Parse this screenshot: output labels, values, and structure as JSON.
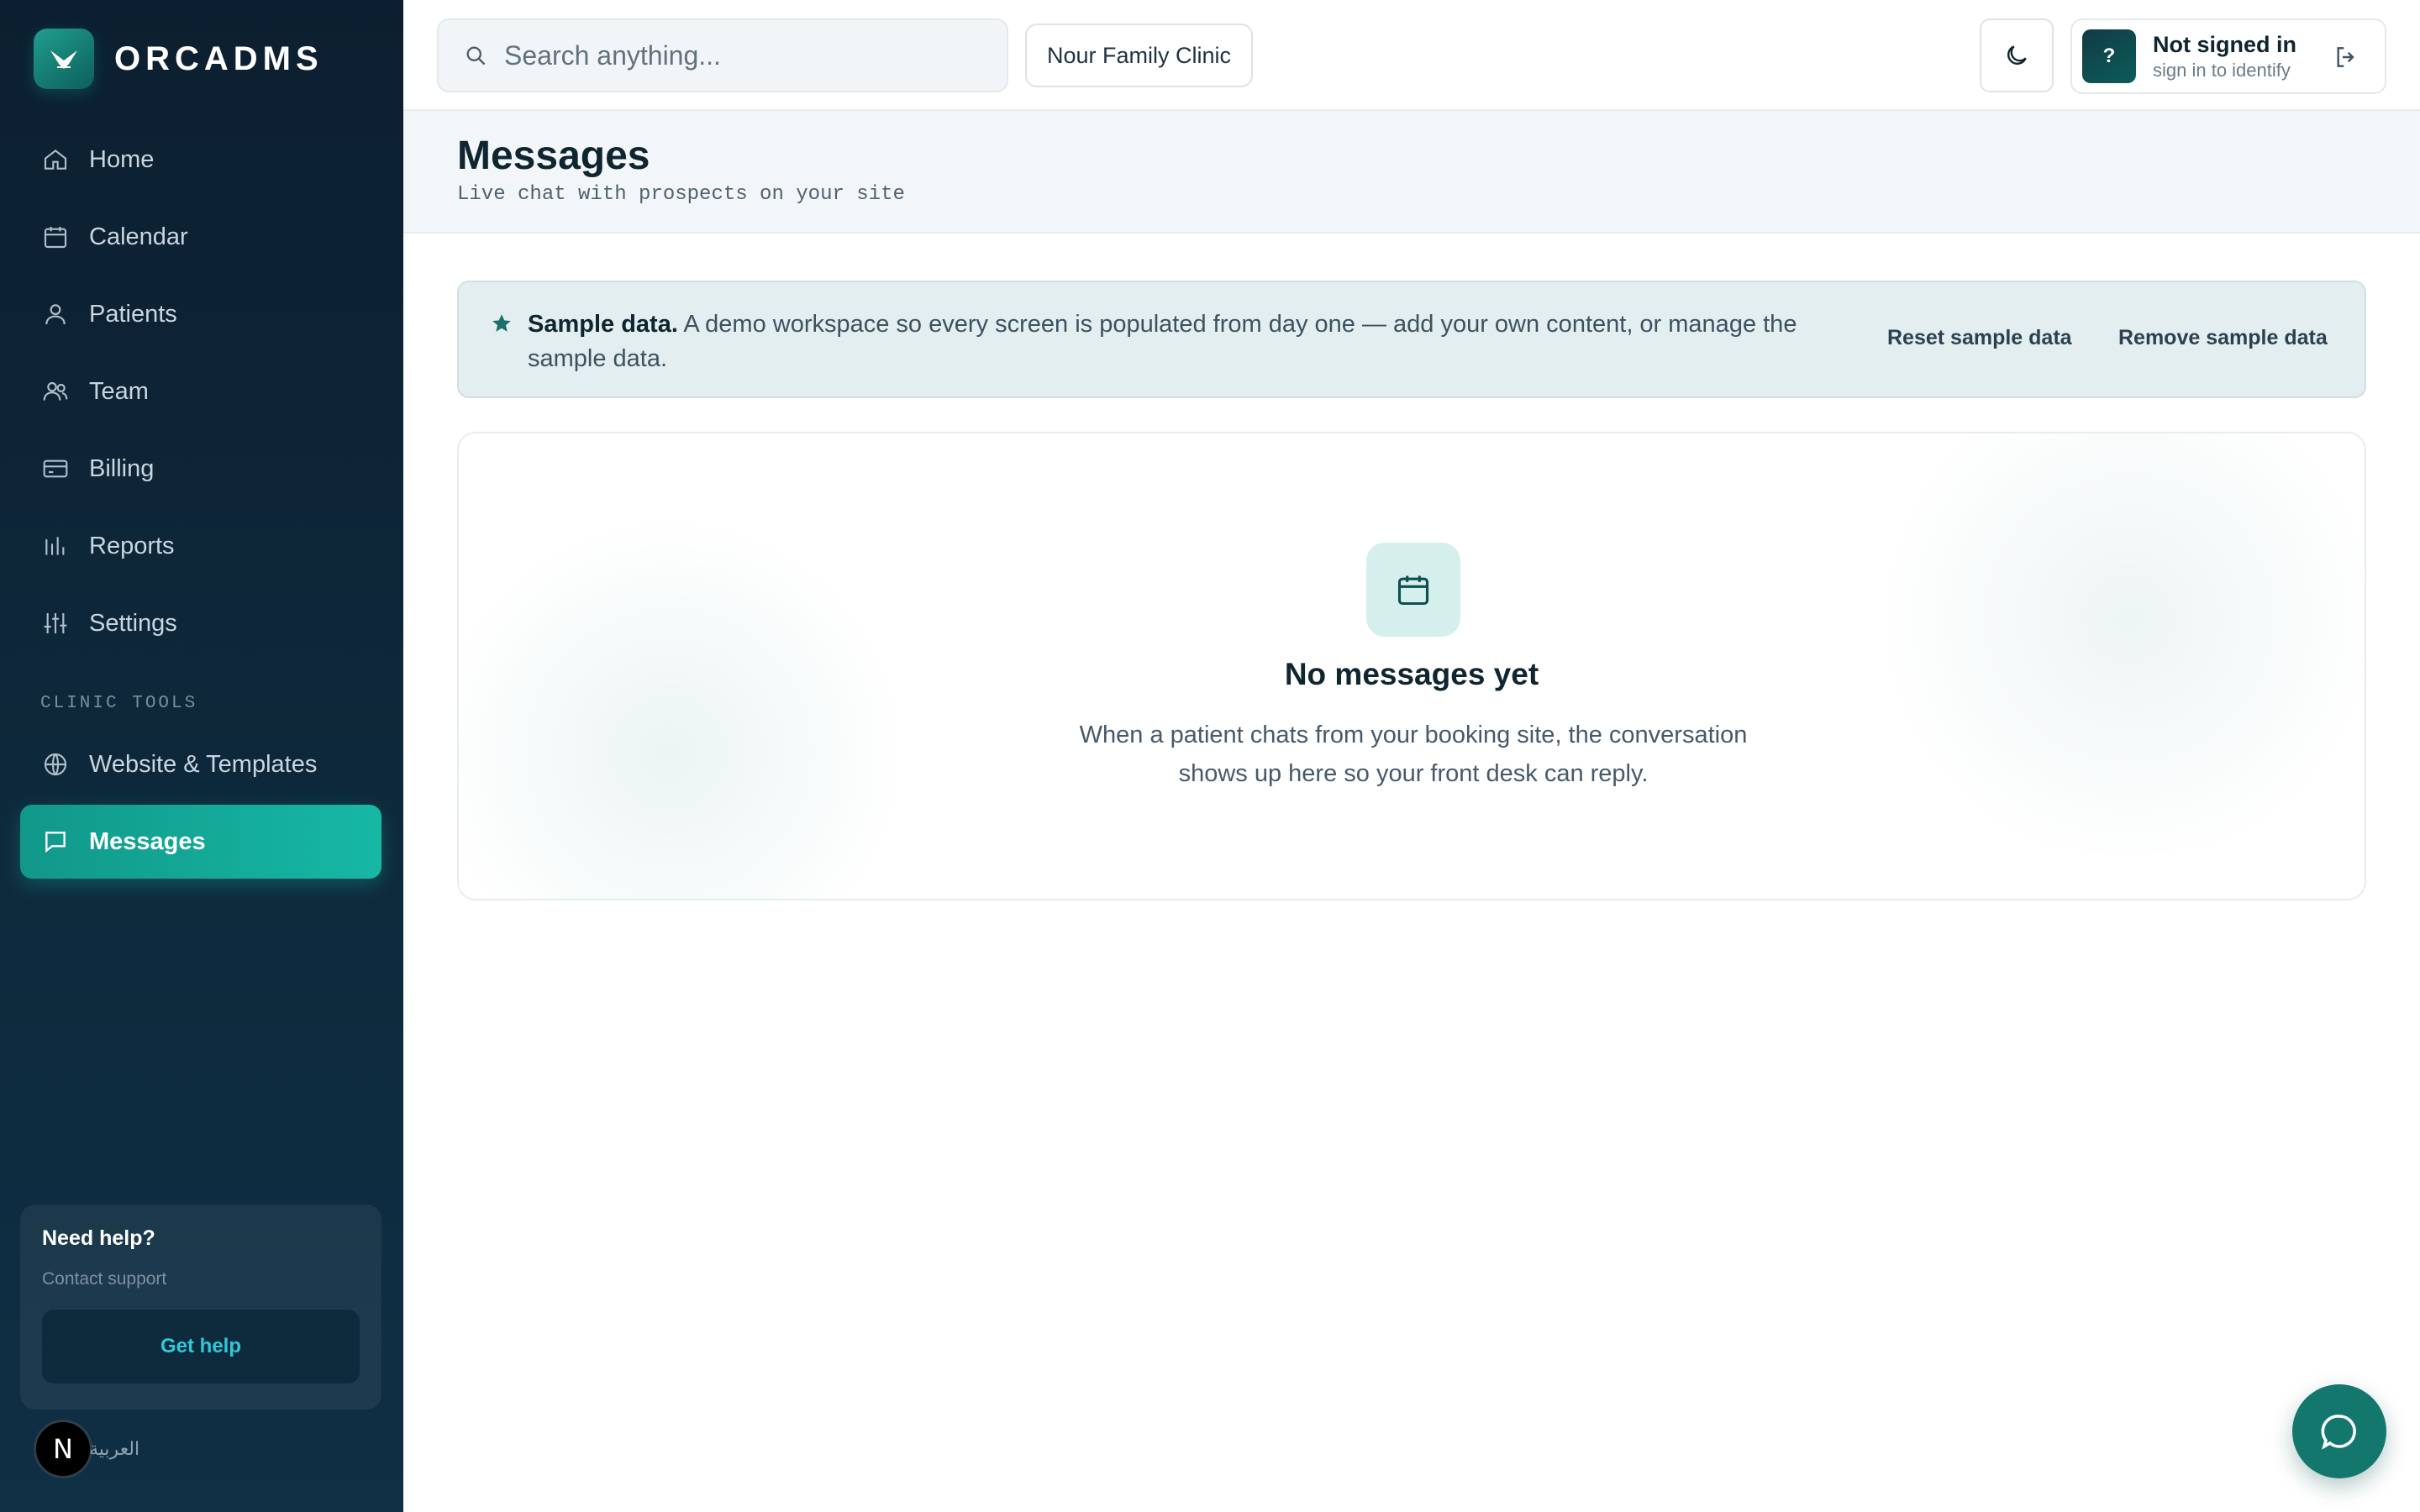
{
  "app": {
    "name": "ORCADMS"
  },
  "sidebar": {
    "items": [
      {
        "label": "Home"
      },
      {
        "label": "Calendar"
      },
      {
        "label": "Patients"
      },
      {
        "label": "Team"
      },
      {
        "label": "Billing"
      },
      {
        "label": "Reports"
      },
      {
        "label": "Settings"
      }
    ],
    "section_label": "CLINIC TOOLS",
    "tools": [
      {
        "label": "Website & Templates"
      },
      {
        "label": "Messages",
        "active": true
      }
    ],
    "help": {
      "title": "Need help?",
      "subtitle": "Contact support",
      "button": "Get help"
    },
    "language": {
      "avatar": "N",
      "label": "العربية"
    }
  },
  "topbar": {
    "search_placeholder": "Search anything...",
    "clinic": "Nour Family Clinic",
    "user": {
      "avatar": "?",
      "name": "Not signed in",
      "subtitle": "sign in to identify"
    }
  },
  "page": {
    "title": "Messages",
    "subtitle": "Live chat with prospects on your site"
  },
  "banner": {
    "strong": "Sample data.",
    "text": " A demo workspace so every screen is populated from day one — add your own content, or manage the sample data.",
    "reset_label": "Reset sample data",
    "remove_label": "Remove sample data"
  },
  "empty_state": {
    "title": "No messages yet",
    "body": "When a patient chats from your booking site, the conversation shows up here so your front desk can reply."
  },
  "colors": {
    "accent": "#16b8a4",
    "sidebar": "#0e2a3d",
    "fab": "#14776e"
  }
}
